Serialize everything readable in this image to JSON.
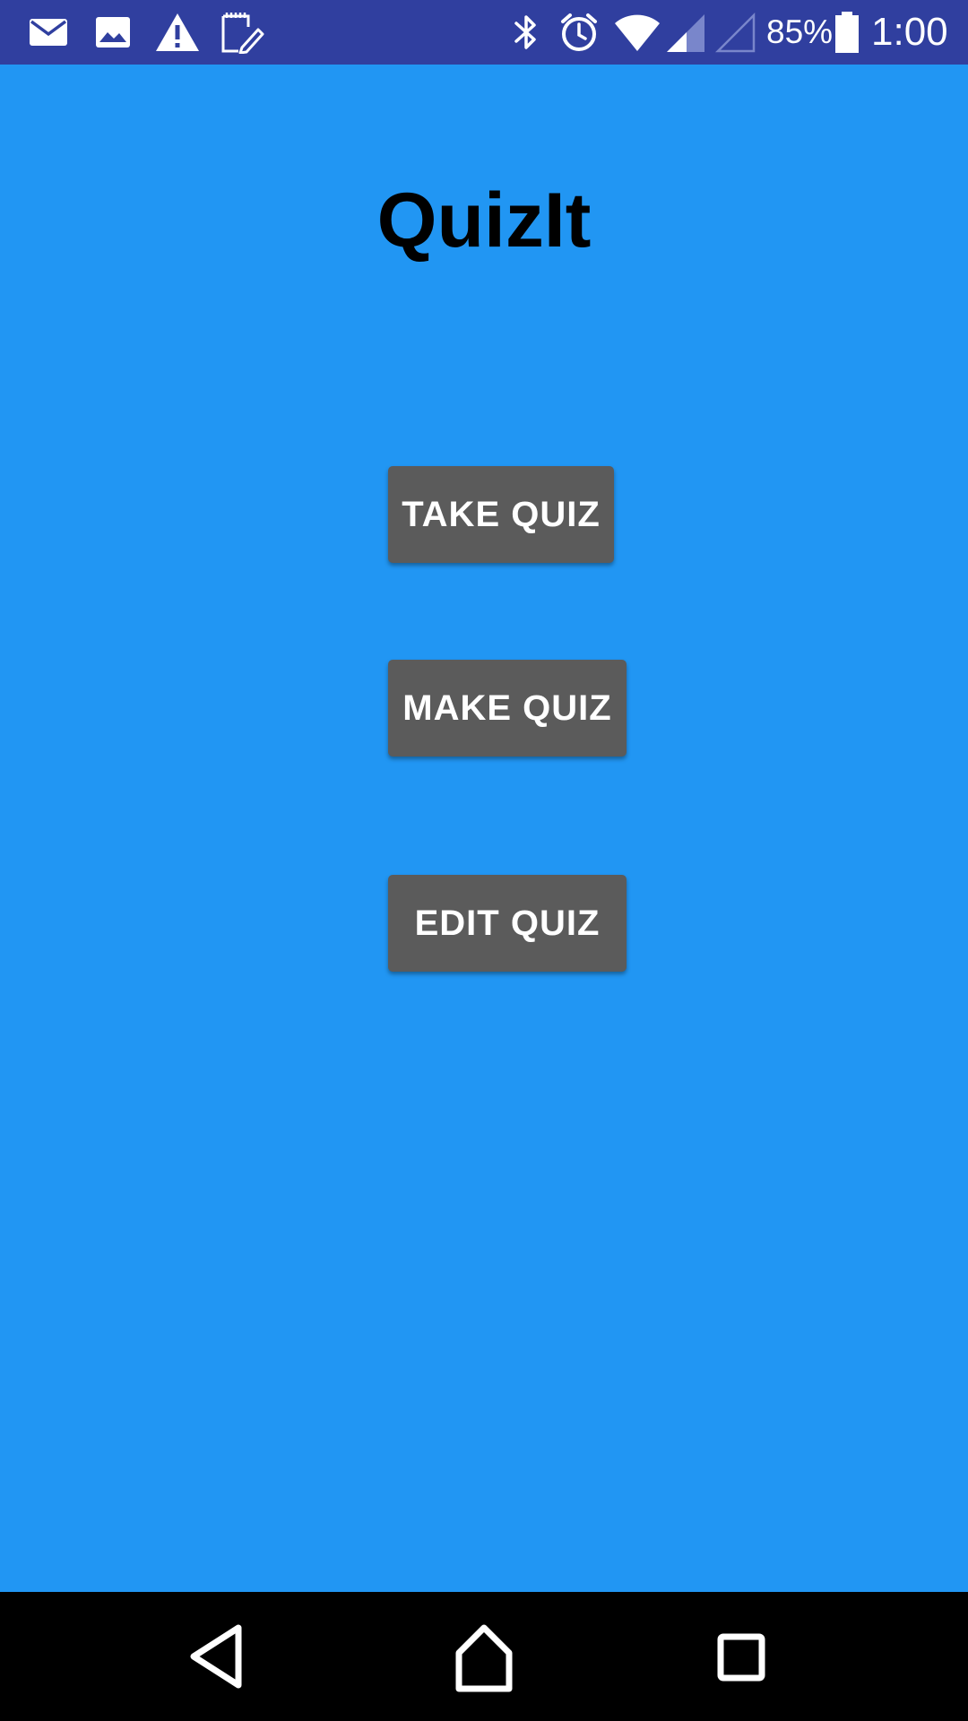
{
  "status_bar": {
    "notification_icons": [
      "mail-icon",
      "image-icon",
      "warning-icon",
      "note-edit-icon"
    ],
    "system_icons": [
      "bluetooth-icon",
      "alarm-icon",
      "wifi-icon",
      "cell-signal-icon",
      "no-sim-signal-icon",
      "battery-icon"
    ],
    "battery_percent": "85%",
    "time": "1:00",
    "color": "#303F9F"
  },
  "app": {
    "title": "QuizIt",
    "background_color": "#2196F3"
  },
  "buttons": {
    "take_quiz": "TAKE QUIZ",
    "make_quiz": "MAKE QUIZ",
    "edit_quiz": "EDIT QUIZ",
    "color": "#5B5B5B"
  },
  "nav_bar": {
    "items": [
      "back-icon",
      "home-icon",
      "recents-icon"
    ]
  }
}
